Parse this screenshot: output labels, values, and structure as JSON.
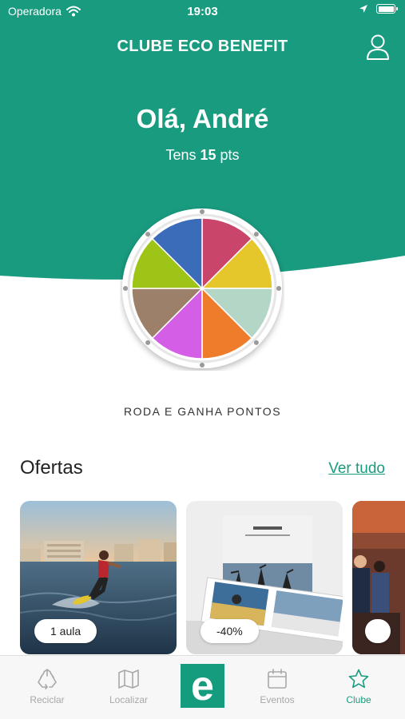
{
  "status_bar": {
    "carrier": "Operadora",
    "time": "19:03"
  },
  "header": {
    "title": "CLUBE ECO BENEFIT",
    "profile_icon": "user-icon"
  },
  "greeting": {
    "text": "Olá, André",
    "points_prefix": "Tens",
    "points_value": "15",
    "points_suffix": "pts"
  },
  "wheel": {
    "caption": "RODA E GANHA PONTOS",
    "segment_colors": [
      "#c9466a",
      "#e6c72b",
      "#b4d6c7",
      "#ee7c2b",
      "#d55ee6",
      "#9c8069",
      "#9ec417",
      "#3a6cba"
    ]
  },
  "offers": {
    "title": "Ofertas",
    "see_all": "Ver tudo",
    "items": [
      {
        "badge": "1 aula",
        "image": "wakeboard-photo"
      },
      {
        "badge": "-40%",
        "image": "photo-book"
      },
      {
        "badge": "",
        "image": "crowd-photo"
      }
    ]
  },
  "tab_bar": {
    "tabs": [
      {
        "label": "Reciclar",
        "icon": "recycle-icon"
      },
      {
        "label": "Localizar",
        "icon": "map-icon"
      },
      {
        "label": "Eventos",
        "icon": "calendar-icon"
      },
      {
        "label": "Clube",
        "icon": "star-icon"
      }
    ],
    "center_logo": "e"
  },
  "colors": {
    "brand_green": "#1a9b7e",
    "inactive": "#a8a8a8"
  }
}
